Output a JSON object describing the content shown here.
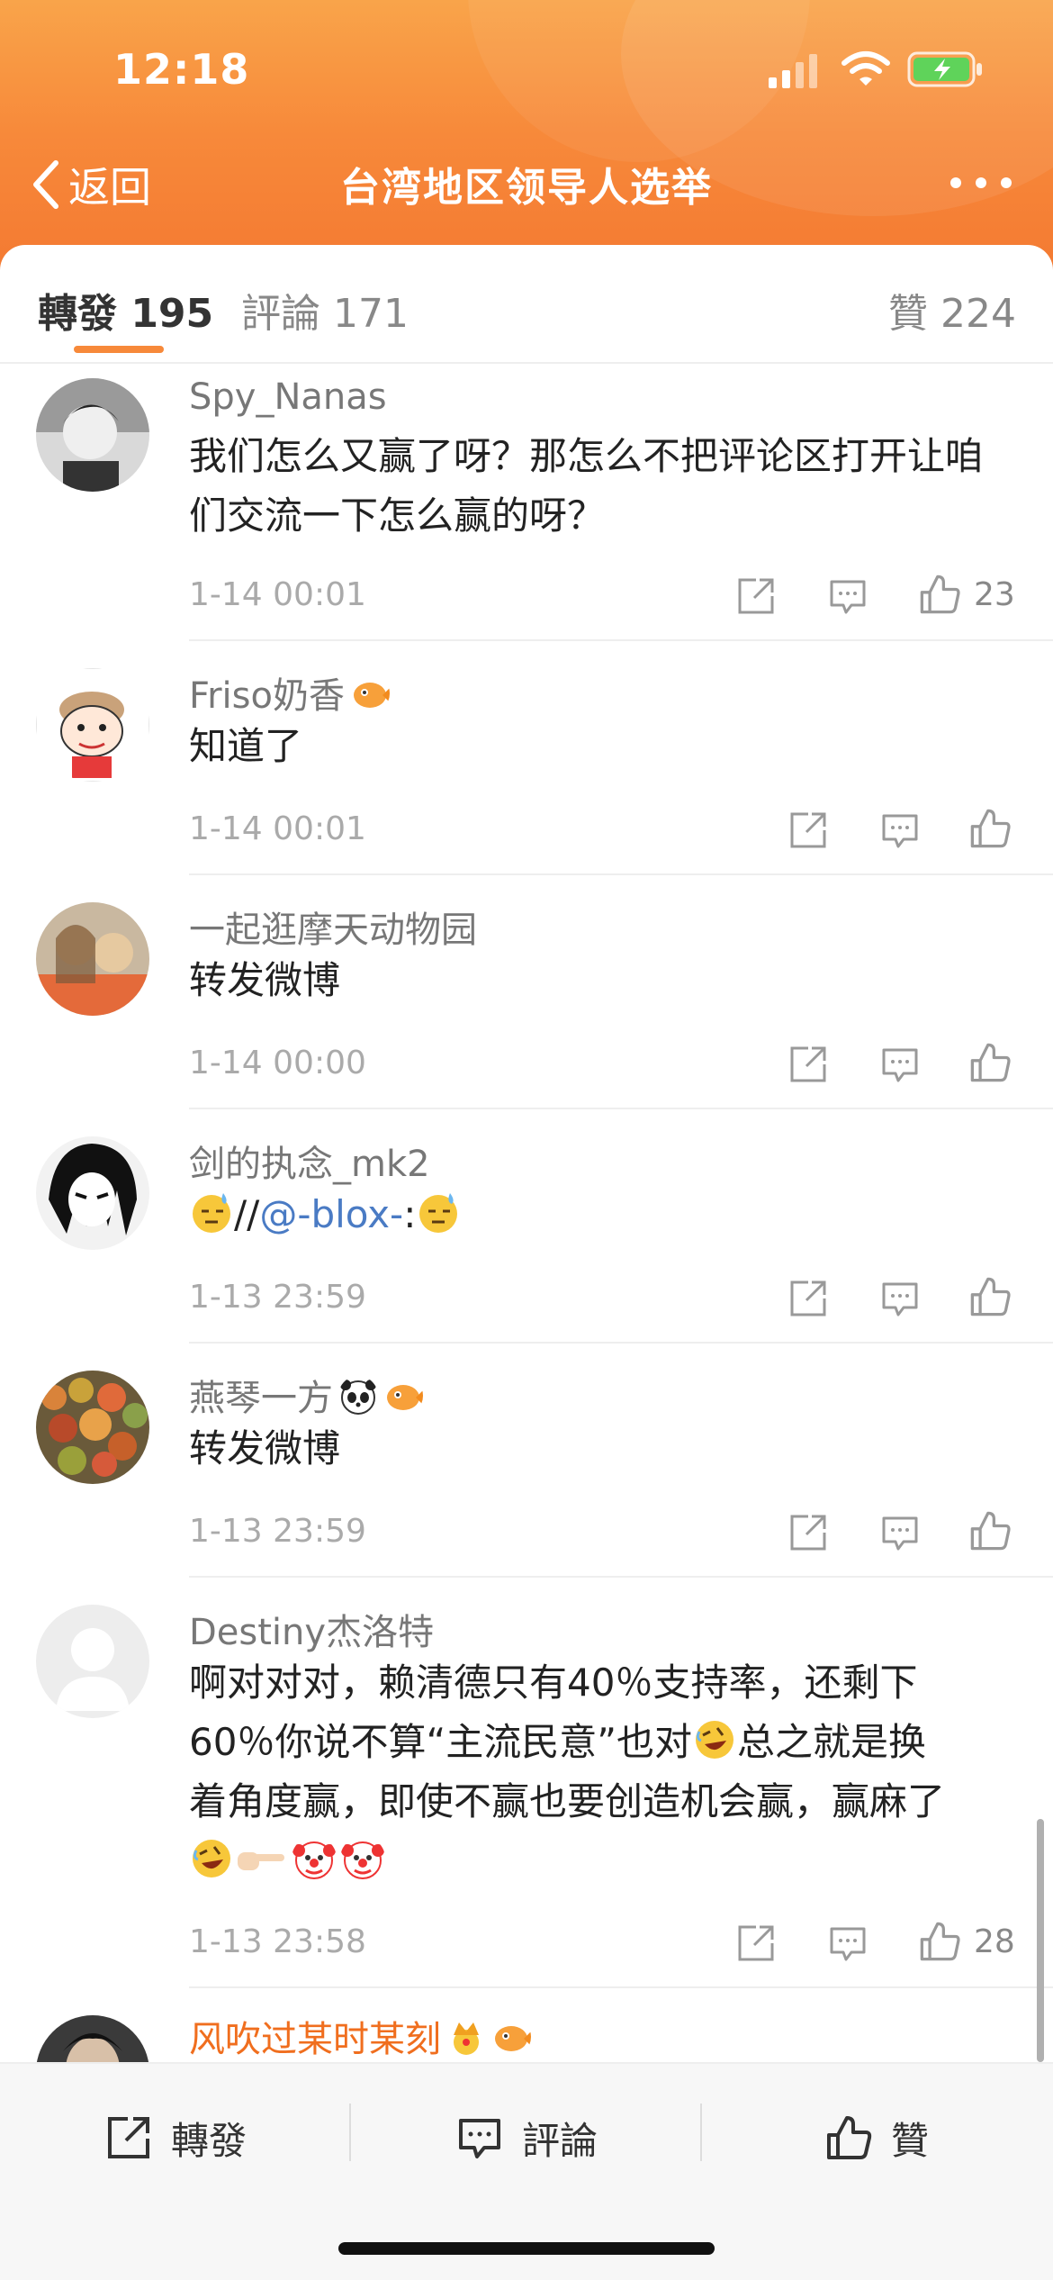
{
  "status_bar": {
    "time": "12:18"
  },
  "nav": {
    "back_label": "返回",
    "title": "台湾地区领导人选举"
  },
  "tabs": [
    {
      "label": "轉發 195",
      "active": true
    },
    {
      "label": "評論 171",
      "active": false
    },
    {
      "label": "贊 224",
      "active": false
    }
  ],
  "comments": [
    {
      "username": "Spy_Nanas",
      "text": "我们怎么又赢了呀？那怎么不把评论区打开让咱们交流一下怎么赢的呀？",
      "time": "1-14 00:01",
      "likes": "23"
    },
    {
      "username": "Friso奶香",
      "text": "知道了",
      "time": "1-14 00:01",
      "likes": ""
    },
    {
      "username": "一起逛摩天动物园",
      "text": "转发微博",
      "time": "1-14 00:00",
      "likes": ""
    },
    {
      "username": "剑的执念_mk2",
      "text_prefix": "//",
      "mention": "@-blox-",
      "text_suffix": ":",
      "time": "1-13 23:59",
      "likes": ""
    },
    {
      "username": "燕琴一方",
      "text": "转发微博",
      "time": "1-13 23:59",
      "likes": ""
    },
    {
      "username": "Destiny杰洛特",
      "text_lines": [
        "啊对对对，赖清德只有40％支持率，还剩下",
        "60％你说不算“主流民意”也对",
        "总之就是换",
        "着角度赢，即使不赢也要创造机会赢，赢麻了"
      ],
      "time": "1-13 23:58",
      "likes": "28"
    },
    {
      "username": "风吹过某时某刻"
    }
  ],
  "bottom_bar": {
    "repost": "轉發",
    "comment": "評論",
    "like": "贊"
  },
  "colors": {
    "accent": "#f7893a",
    "mention": "#4a7bc4",
    "orange_name": "#f06e1e"
  }
}
